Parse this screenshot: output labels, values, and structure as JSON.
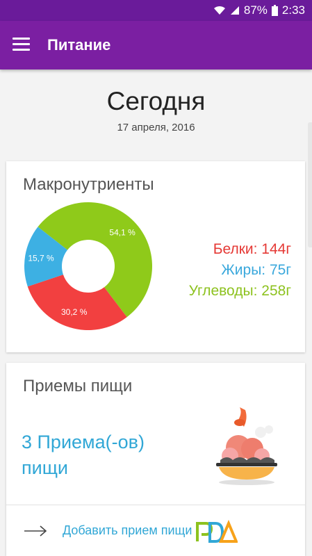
{
  "status_bar": {
    "battery_percent": "87%",
    "time": "2:33",
    "icons": [
      "wifi-icon",
      "signal-icon",
      "battery-icon"
    ]
  },
  "app_bar": {
    "title": "Питание",
    "menu_icon": "hamburger-menu-icon"
  },
  "date": {
    "title": "Сегодня",
    "subtitle": "17 апреля, 2016"
  },
  "macros": {
    "title": "Макронутриенты",
    "legend": {
      "protein": "Белки: 144г",
      "fat": "Жиры: 75г",
      "carbs": "Углеводы: 258г"
    },
    "colors": {
      "protein": "#f24040",
      "fat": "#3db0e3",
      "carbs": "#8fca1a"
    }
  },
  "chart_data": {
    "type": "pie",
    "categories": [
      "Углеводы",
      "Белки",
      "Жиры"
    ],
    "values": [
      54.1,
      30.2,
      15.7
    ],
    "labels": [
      "54,1 %",
      "30,2 %",
      "15,7 %"
    ]
  },
  "meals": {
    "title": "Приемы пищи",
    "count_text": "3 Приема(-ов) пищи",
    "illustration_icon": "meal-bowl-icon",
    "add_label": "Добавить прием пищи",
    "add_icon": "arrow-right-icon",
    "logo_icon": "logo-icon"
  },
  "theme": {
    "primary": "#7b1fa2",
    "primary_dark": "#6a1b9a",
    "accent": "#31a7d6"
  }
}
